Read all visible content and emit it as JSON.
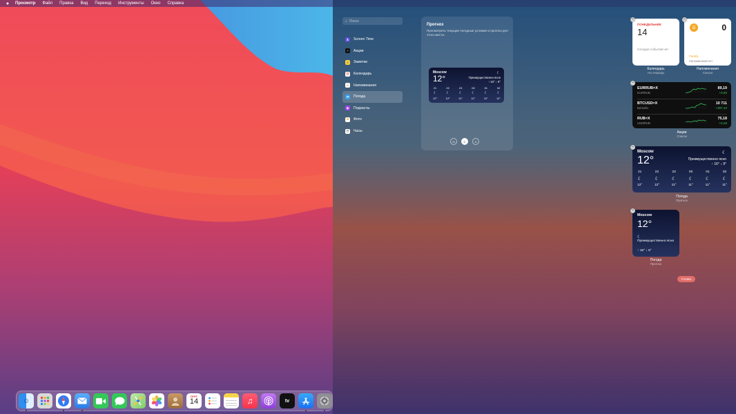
{
  "menubar": {
    "apple": "",
    "items": [
      "Просмотр",
      "Файл",
      "Правка",
      "Вид",
      "Переход",
      "Инструменты",
      "Окно",
      "Справка"
    ]
  },
  "gallery": {
    "search_placeholder": "Поиск",
    "items": [
      {
        "label": "Screen Time",
        "icon": "hourglass-icon",
        "color": "#5b4fd6"
      },
      {
        "label": "Акции",
        "icon": "stocks-icon",
        "color": "#111111"
      },
      {
        "label": "Заметки",
        "icon": "notes-icon",
        "color": "#f4d03f"
      },
      {
        "label": "Календарь",
        "icon": "calendar-icon",
        "color": "#ffffff"
      },
      {
        "label": "Напоминания",
        "icon": "reminders-icon",
        "color": "#ffffff"
      },
      {
        "label": "Погода",
        "icon": "weather-icon",
        "color": "#3ba3f0"
      },
      {
        "label": "Подкасты",
        "icon": "podcasts-icon",
        "color": "#a442e8"
      },
      {
        "label": "Фото",
        "icon": "photos-icon",
        "color": "#ffffff"
      },
      {
        "label": "Часы",
        "icon": "clock-icon",
        "color": "#ffffff"
      }
    ],
    "active_index": 5,
    "preview": {
      "title": "Прогноз",
      "description": "Просмотреть текущие погодные условия и прогноз для этого места.",
      "sizes": [
        "M",
        "C",
        "Б"
      ],
      "selected_size": 1
    }
  },
  "weather": {
    "city": "Moscow",
    "temp": "12°",
    "condition": "Преимущественно ясно",
    "hilo": "↑ 16° ↓ 9°",
    "hours": [
      {
        "time": "21",
        "temp": "12°"
      },
      {
        "time": "22",
        "temp": "12°"
      },
      {
        "time": "23",
        "temp": "11°"
      },
      {
        "time": "00",
        "temp": "11°"
      },
      {
        "time": "01",
        "temp": "11°"
      },
      {
        "time": "02",
        "temp": "11°"
      }
    ]
  },
  "calendar_widget": {
    "day": "ПОНЕДЕЛЬНИК",
    "date": "14",
    "message": "Сегодня событий нет",
    "caption": "Календарь",
    "subcaption": "На очереди"
  },
  "reminders_widget": {
    "count": "0",
    "list": "Family",
    "message": "Напоминаний нет",
    "caption": "Напоминания",
    "subcaption": "Список"
  },
  "stocks_widget": {
    "rows": [
      {
        "symbol": "EURRUB=X",
        "name": "EUR/RUB",
        "price": "89,19",
        "change": "+0,60"
      },
      {
        "symbol": "BTCUSD=X",
        "name": "Биткойн",
        "price": "10 711",
        "change": "+387,22"
      },
      {
        "symbol": "RUB=X",
        "name": "USD/RUB",
        "price": "75,18",
        "change": "+0,28"
      }
    ],
    "caption": "Акции",
    "subcaption": "Список"
  },
  "weather_medium_caption": {
    "caption": "Погода",
    "subcaption": "Прогноз"
  },
  "weather_small_caption": {
    "caption": "Погода",
    "subcaption": "Прогноз"
  },
  "done_label": "Готово",
  "dock": {
    "calendar_month": "СЕНТ.",
    "calendar_day": "14",
    "apps": [
      {
        "name": "finder-icon",
        "color": "#2f8ef0"
      },
      {
        "name": "launchpad-icon",
        "color": "#d9d9d9"
      },
      {
        "name": "safari-icon",
        "color": "#2e7bf5"
      },
      {
        "name": "mail-icon",
        "color": "#3a8ff5"
      },
      {
        "name": "facetime-icon",
        "color": "#34c759"
      },
      {
        "name": "messages-icon",
        "color": "#34c759"
      },
      {
        "name": "maps-icon",
        "color": "#7fcd6a"
      },
      {
        "name": "photos-icon",
        "color": "#ffffff"
      },
      {
        "name": "contacts-icon",
        "color": "#b58a5a"
      },
      {
        "name": "calendar-icon",
        "color": "#ffffff"
      },
      {
        "name": "reminders-icon",
        "color": "#ffffff"
      },
      {
        "name": "notes-icon",
        "color": "#f7d54a"
      },
      {
        "name": "music-icon",
        "color": "#f8334a"
      },
      {
        "name": "podcasts-icon",
        "color": "#a34ee8"
      },
      {
        "name": "tv-icon",
        "color": "#111111"
      },
      {
        "name": "app-store-icon",
        "color": "#1c8cf5"
      },
      {
        "name": "system-preferences-icon",
        "color": "#8e8e93"
      }
    ],
    "tv_label": "tv"
  }
}
